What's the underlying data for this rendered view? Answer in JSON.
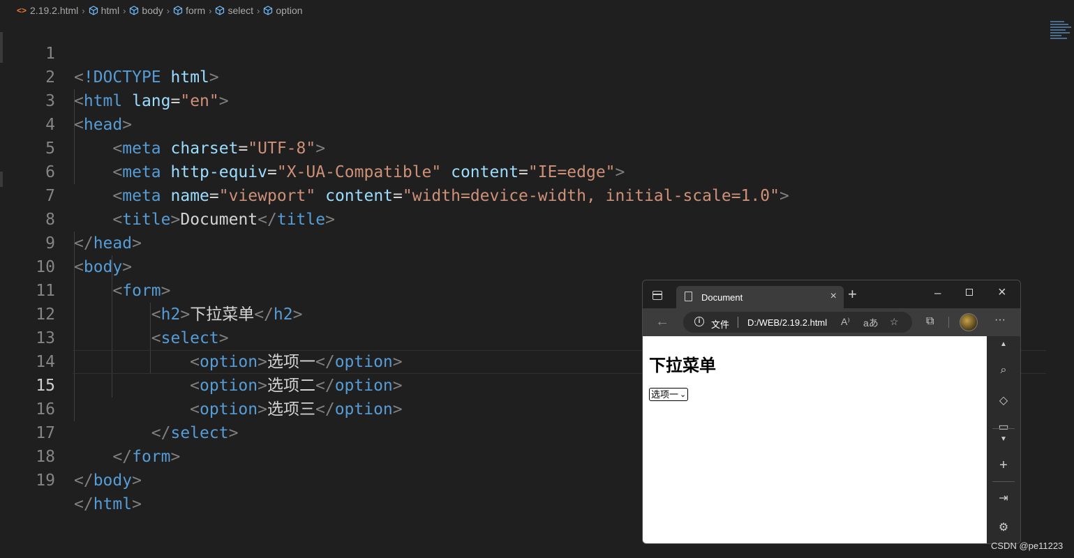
{
  "breadcrumb": {
    "file": "2.19.2.html",
    "items": [
      "html",
      "body",
      "form",
      "select",
      "option"
    ]
  },
  "editor": {
    "current_line": 15,
    "lines": [
      {
        "num": "1"
      },
      {
        "num": "2"
      },
      {
        "num": "3"
      },
      {
        "num": "4"
      },
      {
        "num": "5"
      },
      {
        "num": "6"
      },
      {
        "num": "7"
      },
      {
        "num": "8"
      },
      {
        "num": "9"
      },
      {
        "num": "10"
      },
      {
        "num": "11"
      },
      {
        "num": "12"
      },
      {
        "num": "13"
      },
      {
        "num": "14"
      },
      {
        "num": "15"
      },
      {
        "num": "16"
      },
      {
        "num": "17"
      },
      {
        "num": "18"
      },
      {
        "num": "19"
      }
    ],
    "tokens": {
      "doctype": "!DOCTYPE",
      "html": "html",
      "lang": "lang",
      "en": "\"en\"",
      "head": "head",
      "meta": "meta",
      "charset": "charset",
      "utf8": "\"UTF-8\"",
      "http_equiv": "http-equiv",
      "xua": "\"X-UA-Compatible\"",
      "content": "content",
      "ieedge": "\"IE=edge\"",
      "name": "name",
      "viewport": "\"viewport\"",
      "vp_content": "\"width=device-width, initial-scale=1.0\"",
      "title": "title",
      "document": "Document",
      "body": "body",
      "form": "form",
      "h2": "h2",
      "h2_text": "下拉菜单",
      "select": "select",
      "option": "option",
      "opt1": "选项一",
      "opt2": "选项二",
      "opt3": "选项三"
    }
  },
  "browser": {
    "tab_title": "Document",
    "protocol_label": "文件",
    "url": "D:/WEB/2.19.2.html",
    "page": {
      "heading": "下拉菜单",
      "select_value": "选项一"
    }
  },
  "watermark": "CSDN @pe11223",
  "colors": {
    "editor_bg": "#1f1f1f",
    "tag": "#569cd6",
    "attribute": "#9cdcfe",
    "string": "#ce9178",
    "punctuation": "#808080",
    "text": "#d4d4d4"
  }
}
